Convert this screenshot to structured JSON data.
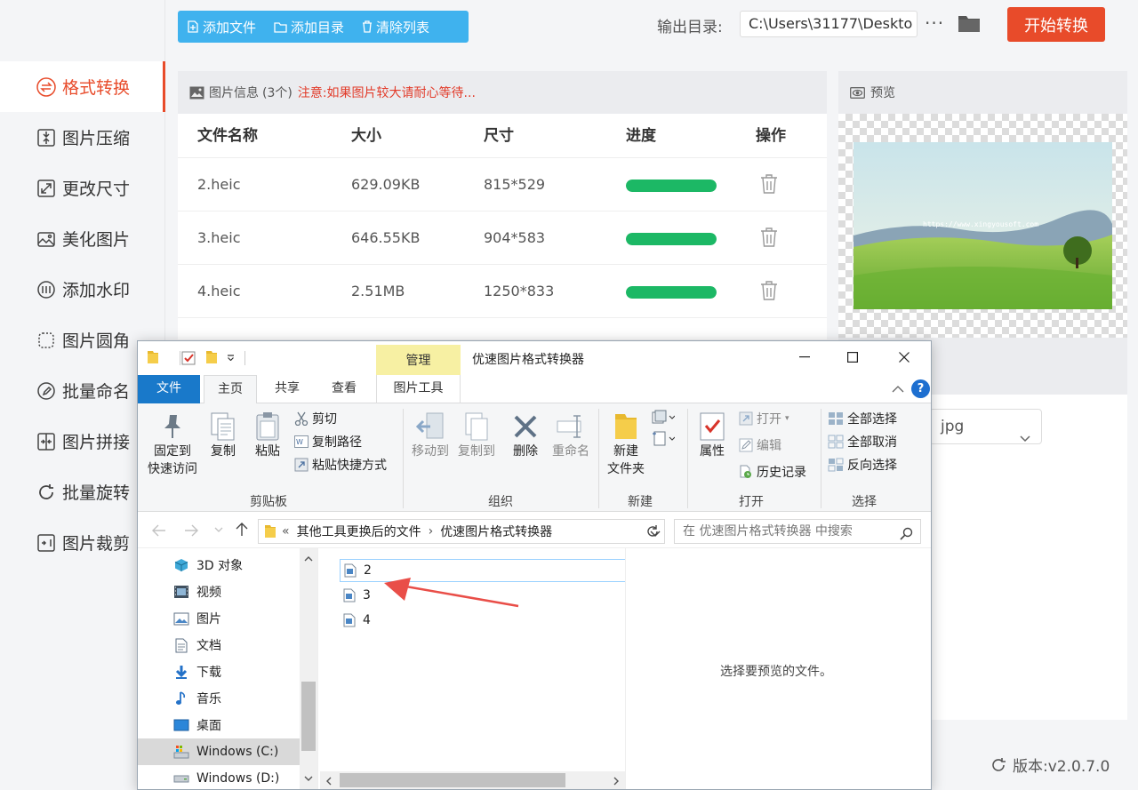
{
  "app": {
    "toolbar": {
      "add_file": "添加文件",
      "add_folder": "添加目录",
      "clear_list": "清除列表"
    },
    "output": {
      "label": "输出目录:",
      "path": "C:\\Users\\31177\\Deskto",
      "more": "···"
    },
    "start_button": "开始转换",
    "sidebar": {
      "items": [
        {
          "label": "格式转换",
          "icon": "format-convert-icon",
          "active": true
        },
        {
          "label": "图片压缩",
          "icon": "compress-icon"
        },
        {
          "label": "更改尺寸",
          "icon": "resize-icon"
        },
        {
          "label": "美化图片",
          "icon": "beautify-icon"
        },
        {
          "label": "添加水印",
          "icon": "watermark-icon"
        },
        {
          "label": "图片圆角",
          "icon": "round-corner-icon"
        },
        {
          "label": "批量命名",
          "icon": "rename-icon"
        },
        {
          "label": "图片拼接",
          "icon": "stitch-icon"
        },
        {
          "label": "批量旋转",
          "icon": "rotate-icon"
        },
        {
          "label": "图片裁剪",
          "icon": "crop-icon"
        }
      ]
    },
    "info": {
      "title": "图片信息",
      "count": "(3个)",
      "notice": "注意:如果图片较大请耐心等待..."
    },
    "table": {
      "headers": [
        "文件名称",
        "大小",
        "尺寸",
        "进度",
        "操作"
      ],
      "rows": [
        {
          "name": "2.heic",
          "size": "629.09KB",
          "dims": "815*529",
          "progress": 1.0
        },
        {
          "name": "3.heic",
          "size": "646.55KB",
          "dims": "904*583",
          "progress": 1.0
        },
        {
          "name": "4.heic",
          "size": "2.51MB",
          "dims": "1250*833",
          "progress": 1.0
        }
      ]
    },
    "preview": {
      "title": "预览",
      "watermark": "https://www.xingyousoft.com"
    },
    "format_select": "jpg",
    "version": "版本:v2.0.7.0",
    "colors": {
      "accent": "#e84b2a",
      "toolbar": "#3fb2ee",
      "progress": "#1cb865",
      "explorer_file_tab": "#1979ca",
      "manage_tab": "#f7f0a3"
    }
  },
  "explorer": {
    "title": "优速图片格式转换器",
    "manage_tab": "管理",
    "tabs": [
      "文件",
      "主页",
      "共享",
      "查看",
      "图片工具"
    ],
    "ribbon": {
      "clipboard": {
        "label": "剪贴板",
        "pin": "固定到\n快速访问",
        "pin_line1": "固定到",
        "pin_line2": "快速访问",
        "copy": "复制",
        "paste": "粘贴",
        "cut": "剪切",
        "copy_path": "复制路径",
        "paste_shortcut": "粘贴快捷方式"
      },
      "organize": {
        "label": "组织",
        "move_to": "移动到",
        "copy_to": "复制到",
        "delete": "删除",
        "rename": "重命名"
      },
      "new": {
        "label": "新建",
        "new_folder_line1": "新建",
        "new_folder_line2": "文件夹"
      },
      "open": {
        "label": "打开",
        "properties": "属性",
        "open": "打开",
        "edit": "编辑",
        "history": "历史记录"
      },
      "select": {
        "label": "选择",
        "select_all": "全部选择",
        "select_none": "全部取消",
        "invert": "反向选择"
      }
    },
    "address": {
      "prefix": "«",
      "crumb1": "其他工具更换后的文件",
      "sep": "›",
      "crumb2": "优速图片格式转换器"
    },
    "search_placeholder": "在 优速图片格式转换器 中搜索",
    "nav": [
      {
        "label": "3D 对象",
        "icon": "3d-objects-icon"
      },
      {
        "label": "视频",
        "icon": "video-icon"
      },
      {
        "label": "图片",
        "icon": "pictures-icon"
      },
      {
        "label": "文档",
        "icon": "documents-icon"
      },
      {
        "label": "下载",
        "icon": "downloads-icon"
      },
      {
        "label": "音乐",
        "icon": "music-icon"
      },
      {
        "label": "桌面",
        "icon": "desktop-icon"
      },
      {
        "label": "Windows (C:)",
        "icon": "drive-c-icon",
        "selected": true
      },
      {
        "label": "Windows (D:)",
        "icon": "drive-d-icon"
      }
    ],
    "files": [
      "2",
      "3",
      "4"
    ],
    "preview_message": "选择要预览的文件。"
  }
}
